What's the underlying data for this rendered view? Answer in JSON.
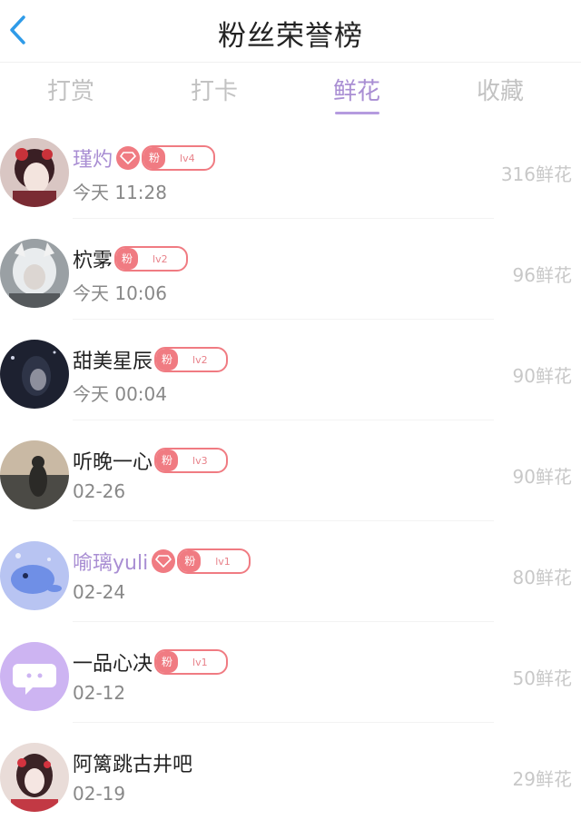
{
  "header": {
    "title": "粉丝荣誉榜"
  },
  "tabs": [
    {
      "label": "打赏",
      "active": false
    },
    {
      "label": "打卡",
      "active": false
    },
    {
      "label": "鲜花",
      "active": true
    },
    {
      "label": "收藏",
      "active": false
    }
  ],
  "colors": {
    "accent": "#a98ed3",
    "badge": "#f07b82",
    "back": "#2f9be8"
  },
  "fans": [
    {
      "name": "瑾灼",
      "vip": true,
      "badge_text": "粉",
      "level": "lv4",
      "time": "今天 11:28",
      "value": "316鲜花"
    },
    {
      "name": "柼雺",
      "vip": false,
      "badge_text": "粉",
      "level": "lv2",
      "time": "今天 10:06",
      "value": "96鲜花"
    },
    {
      "name": "甜美星辰",
      "vip": false,
      "badge_text": "粉",
      "level": "lv2",
      "time": "今天 00:04",
      "value": "90鲜花"
    },
    {
      "name": "听晚一心",
      "vip": false,
      "badge_text": "粉",
      "level": "lv3",
      "time": "02-26",
      "value": "90鲜花"
    },
    {
      "name": "喻璃yuli",
      "vip": true,
      "badge_text": "粉",
      "level": "lv1",
      "time": "02-24",
      "value": "80鲜花"
    },
    {
      "name": "一品心决",
      "vip": false,
      "badge_text": "粉",
      "level": "lv1",
      "time": "02-12",
      "value": "50鲜花"
    },
    {
      "name": "阿篱跳古井吧",
      "vip": false,
      "badge_text": "",
      "level": "",
      "time": "02-19",
      "value": "29鲜花"
    }
  ]
}
